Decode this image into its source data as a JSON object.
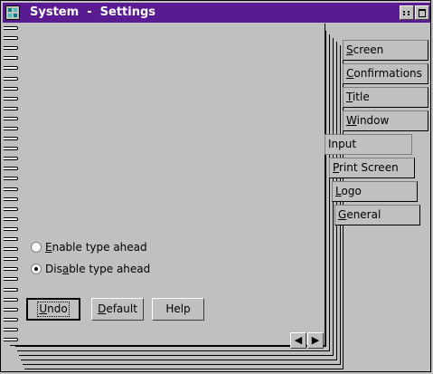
{
  "window": {
    "title": "System  -  Settings"
  },
  "tabs": [
    {
      "label": "Screen",
      "key": "S",
      "rest": "creen"
    },
    {
      "label": "Confirmations",
      "key": "C",
      "rest": "onfirmations"
    },
    {
      "label": "Title",
      "key": "T",
      "rest": "itle"
    },
    {
      "label": "Window",
      "key": "W",
      "rest": "indow"
    },
    {
      "label": "Input",
      "active": true
    },
    {
      "label": "Print Screen",
      "key": "P",
      "rest": "rint Screen"
    },
    {
      "label": "Logo",
      "key": "L",
      "rest": "ogo"
    },
    {
      "label": "General",
      "key": "G",
      "rest": "eneral"
    }
  ],
  "options": {
    "enable": {
      "pre": "",
      "key": "E",
      "post": "nable type ahead",
      "checked": false
    },
    "disable": {
      "pre": "Dis",
      "key": "a",
      "post": "ble type ahead",
      "checked": true
    }
  },
  "buttons": {
    "undo": {
      "key": "U",
      "rest": "ndo"
    },
    "default": {
      "key": "D",
      "rest": "efault"
    },
    "help": {
      "label": "Help"
    }
  },
  "nav": {
    "prev": "◀",
    "next": "▶"
  }
}
